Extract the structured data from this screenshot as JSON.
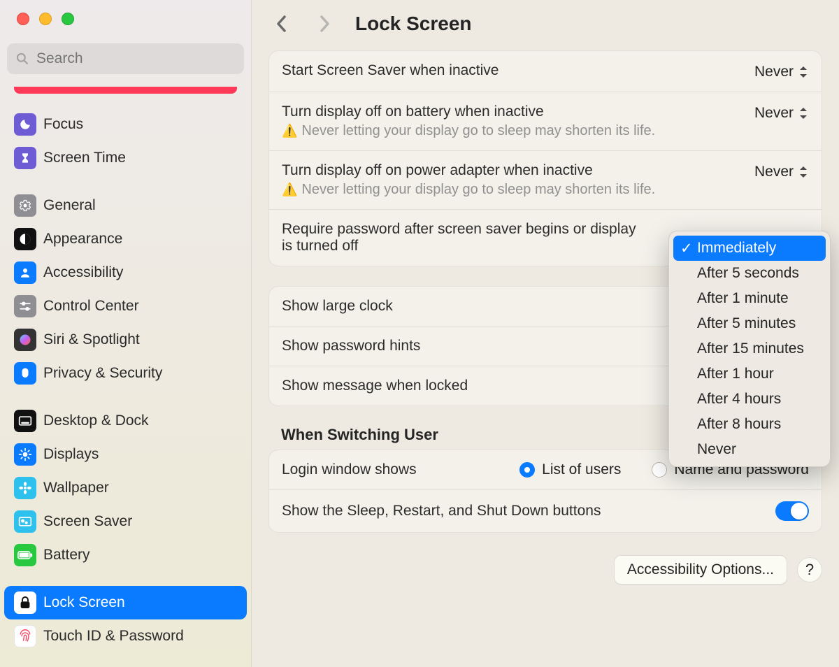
{
  "search": {
    "placeholder": "Search"
  },
  "sidebar": {
    "items": [
      {
        "label": "Focus",
        "name": "sidebar-item-focus",
        "icon": "moon-icon",
        "color": "#6e5cd4"
      },
      {
        "label": "Screen Time",
        "name": "sidebar-item-screen-time",
        "icon": "hourglass-icon",
        "color": "#6e5cd4"
      },
      {
        "label": "General",
        "name": "sidebar-item-general",
        "icon": "gear-icon",
        "color": "#8e8e93"
      },
      {
        "label": "Appearance",
        "name": "sidebar-item-appearance",
        "icon": "contrast-icon",
        "color": "#111111"
      },
      {
        "label": "Accessibility",
        "name": "sidebar-item-accessibility",
        "icon": "person-icon",
        "color": "#0a7bff"
      },
      {
        "label": "Control Center",
        "name": "sidebar-item-control-center",
        "icon": "sliders-icon",
        "color": "#8e8e93"
      },
      {
        "label": "Siri & Spotlight",
        "name": "sidebar-item-siri-spotlight",
        "icon": "siri-icon",
        "color": "#333333"
      },
      {
        "label": "Privacy & Security",
        "name": "sidebar-item-privacy-security",
        "icon": "hand-icon",
        "color": "#0a7bff"
      },
      {
        "label": "Desktop & Dock",
        "name": "sidebar-item-desktop-dock",
        "icon": "dock-icon",
        "color": "#111111"
      },
      {
        "label": "Displays",
        "name": "sidebar-item-displays",
        "icon": "brightness-icon",
        "color": "#0a7bff"
      },
      {
        "label": "Wallpaper",
        "name": "sidebar-item-wallpaper",
        "icon": "flower-icon",
        "color": "#2fc1ee"
      },
      {
        "label": "Screen Saver",
        "name": "sidebar-item-screen-saver",
        "icon": "screensaver-icon",
        "color": "#2fc1ee"
      },
      {
        "label": "Battery",
        "name": "sidebar-item-battery",
        "icon": "battery-icon",
        "color": "#28c840"
      },
      {
        "label": "Lock Screen",
        "name": "sidebar-item-lock-screen",
        "icon": "lock-icon",
        "color": "#111111",
        "selected": true
      },
      {
        "label": "Touch ID & Password",
        "name": "sidebar-item-touch-id",
        "icon": "fingerprint-icon",
        "color": "#ffffff"
      }
    ]
  },
  "header": {
    "title": "Lock Screen"
  },
  "settings": {
    "screensaver": {
      "label": "Start Screen Saver when inactive",
      "value": "Never"
    },
    "battery_off": {
      "label": "Turn display off on battery when inactive",
      "value": "Never",
      "warn": "Never letting your display go to sleep may shorten its life."
    },
    "power_off": {
      "label": "Turn display off on power adapter when inactive",
      "value": "Never",
      "warn": "Never letting your display go to sleep may shorten its life."
    },
    "password": {
      "label": "Require password after screen saver begins or display is turned off"
    },
    "large_clock": {
      "label": "Show large clock"
    },
    "hints": {
      "label": "Show password hints"
    },
    "message": {
      "label": "Show message when locked"
    }
  },
  "switching": {
    "title": "When Switching User",
    "login_shows": "Login window shows",
    "opt_list": "List of users",
    "opt_name": "Name and password",
    "sleep_label": "Show the Sleep, Restart, and Shut Down buttons"
  },
  "bottom": {
    "accessibility": "Accessibility Options...",
    "help": "?"
  },
  "menu": {
    "options": [
      "Immediately",
      "After 5 seconds",
      "After 1 minute",
      "After 5 minutes",
      "After 15 minutes",
      "After 1 hour",
      "After 4 hours",
      "After 8 hours",
      "Never"
    ],
    "selected_index": 0
  }
}
